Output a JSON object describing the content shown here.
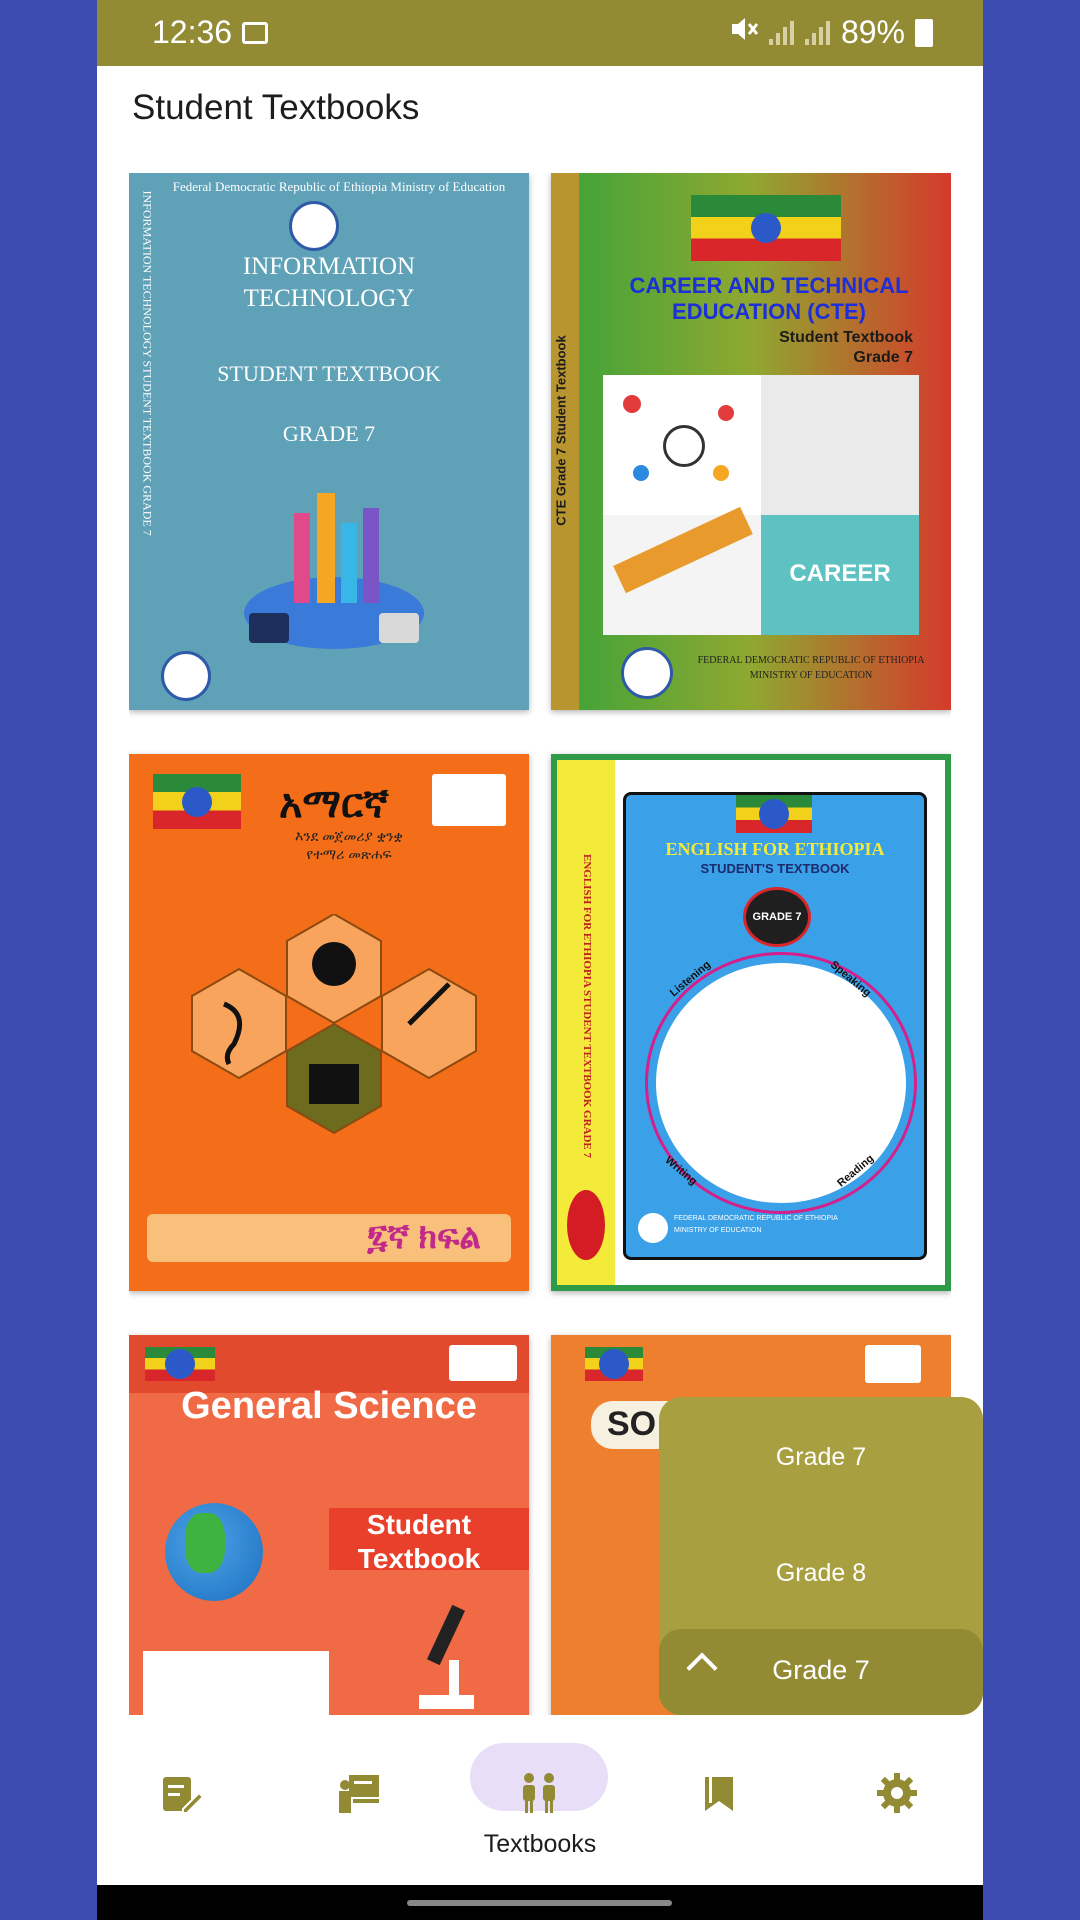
{
  "status_bar": {
    "time": "12:36",
    "battery": "89%"
  },
  "page": {
    "title": "Student Textbooks"
  },
  "books": [
    {
      "lines": [
        "Federal Democratic Republic of Ethiopia Ministry of Education",
        "INFORMATION",
        "TECHNOLOGY",
        "STUDENT TEXTBOOK",
        "GRADE 7"
      ],
      "spine": "INFORMATION TECHNOLOGY   STUDENT TEXTBOOK GRADE 7"
    },
    {
      "lines": [
        "CAREER AND TECHNICAL",
        "EDUCATION (CTE)",
        "Student Textbook",
        "Grade 7",
        "CAREER",
        "FEDERAL DEMOCRATIC REPUBLIC OF ETHIOPIA",
        "MINISTRY OF EDUCATION"
      ],
      "spine": "CTE   Grade 7   Student Textbook"
    },
    {
      "lines": [
        "አማርኛ",
        "እንደ መጀመሪያ ቋንቋ",
        "የተማሪ መጽሐፍ",
        "፯ኛ ክፍል"
      ]
    },
    {
      "lines": [
        "ENGLISH FOR ETHIOPIA",
        "STUDENT'S TEXTBOOK",
        "GRADE 7",
        "Listening",
        "Speaking",
        "Writing",
        "Reading",
        "FEDERAL DEMOCRATIC REPUBLIC OF ETHIOPIA",
        "MINISTRY OF EDUCATION"
      ],
      "spine": "ENGLISH FOR ETHIOPIA    STUDENT TEXTBOOK    GRADE 7"
    },
    {
      "lines": [
        "General Science",
        "Student",
        "Textbook"
      ]
    },
    {
      "lines": [
        "SO"
      ]
    }
  ],
  "grade_dropdown": {
    "options": [
      "Grade 7",
      "Grade 8"
    ],
    "selected": "Grade 7",
    "colors": {
      "menu": "#a8a040",
      "selected": "#938a34"
    }
  },
  "bottom_nav": {
    "items": [
      {
        "icon": "notes-edit-icon"
      },
      {
        "icon": "teacher-board-icon"
      },
      {
        "icon": "students-icon",
        "label": "Textbooks",
        "active": true
      },
      {
        "icon": "bookmarks-icon"
      },
      {
        "icon": "settings-gear-icon"
      }
    ],
    "colors": {
      "icon": "#938a34",
      "active_pill": "#e8def7"
    }
  },
  "colors": {
    "status_bar": "#938a34",
    "background": "#3d4cb0"
  }
}
